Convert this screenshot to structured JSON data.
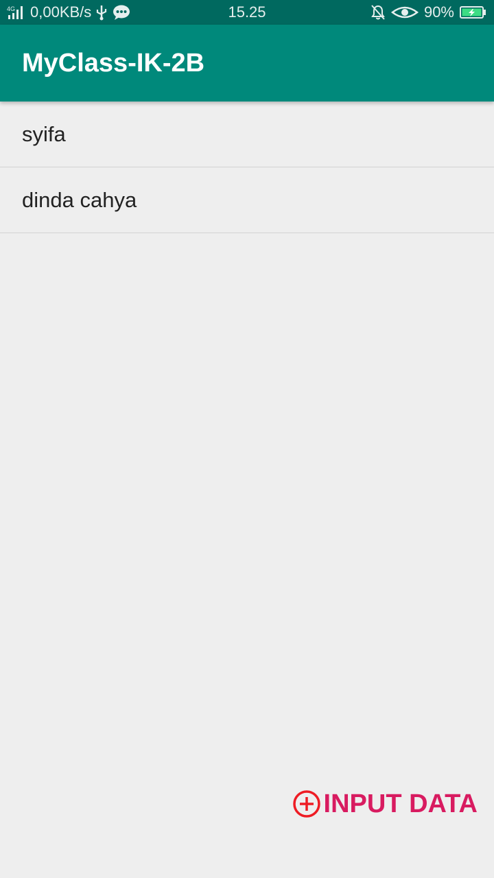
{
  "status_bar": {
    "network": "4G",
    "data_speed": "0,00KB/s",
    "time": "15.25",
    "battery": "90%"
  },
  "app_bar": {
    "title": "MyClass-IK-2B"
  },
  "list": {
    "items": [
      {
        "label": "syifa"
      },
      {
        "label": "dinda cahya"
      }
    ]
  },
  "action": {
    "label": "INPUT DATA",
    "icon": "add-circle-icon"
  },
  "colors": {
    "status_bar": "#00695f",
    "primary": "#00897b",
    "accent": "#d81b60",
    "background": "#eeeeee"
  }
}
